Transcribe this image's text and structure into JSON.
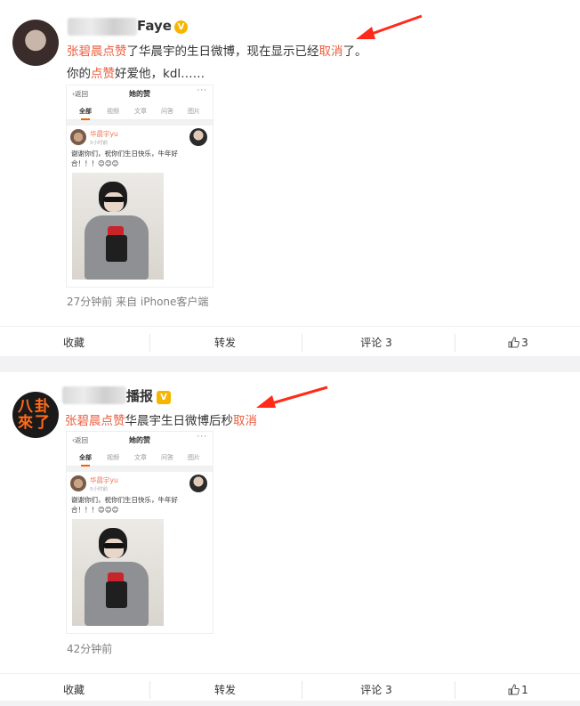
{
  "posts": [
    {
      "user_name": "Faye",
      "badge": "V",
      "line1_red1": "张碧晨点赞",
      "line1_mid": "了华晨宇的生日微博，现在显示已经",
      "line1_red2": "取消",
      "line1_end": "了。",
      "line2_start": "你的",
      "line2_red": "点赞",
      "line2_end": "好爱他，kdl……",
      "meta": "27分钟前  来自 iPhone客户端",
      "screenshot": {
        "back": "‹返回",
        "title": "她的赞",
        "more": "···",
        "tabs": [
          "全部",
          "视频",
          "文章",
          "问答",
          "图片"
        ],
        "author": "华晨宇yu",
        "time": "5小时前",
        "text": "谢谢你们，祝你们生日快乐，牛年好合！！！😊😊😊"
      },
      "actions": {
        "favorite": "收藏",
        "repost": "转发",
        "comment": "评论 3",
        "like": "3"
      }
    },
    {
      "user_name": "播报",
      "badge": "V",
      "avatar_text": "八卦來了",
      "line1_red1": "张碧晨点赞",
      "line1_mid": "华晨宇生日微博后秒",
      "line1_red2": "取消",
      "meta": "42分钟前",
      "screenshot": {
        "back": "‹返回",
        "title": "她的赞",
        "more": "···",
        "tabs": [
          "全部",
          "视频",
          "文章",
          "问答",
          "图片"
        ],
        "author": "华晨宇yu",
        "time": "5小时前",
        "text": "谢谢你们，祝你们生日快乐，牛年好合！！！😊😊😊"
      },
      "actions": {
        "favorite": "收藏",
        "repost": "转发",
        "comment": "评论 3",
        "like": "1"
      }
    }
  ],
  "colors": {
    "highlight": "#eb5e3f",
    "arrow": "#ff2a1a",
    "badge": "#f7b500",
    "page_bg": "#f2f2f5"
  },
  "icons": [
    "avatar",
    "verified-badge-icon",
    "red-arrow-icon",
    "thumb-up-icon"
  ]
}
